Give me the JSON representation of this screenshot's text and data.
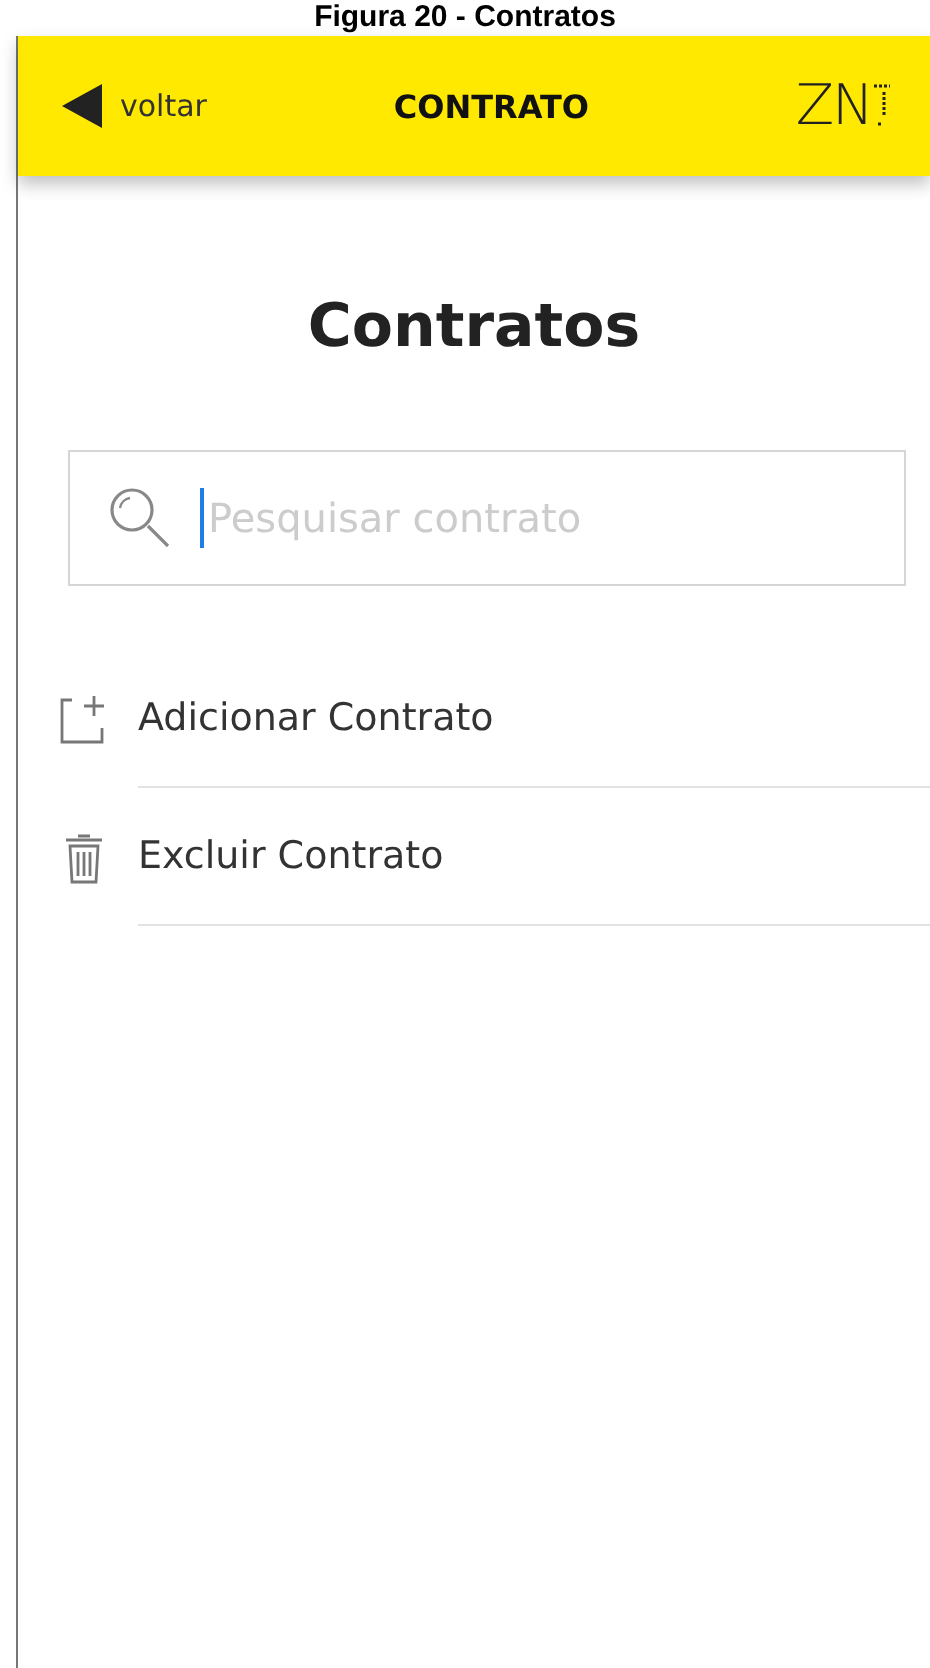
{
  "caption": "Figura 20 - Contratos",
  "header": {
    "back": "voltar",
    "title": "CONTRATO",
    "logo": "ZN"
  },
  "page_title": "Contratos",
  "search": {
    "placeholder": "Pesquisar contrato",
    "focused": true
  },
  "actions": [
    {
      "kind": "add",
      "label": "Adicionar Contrato"
    },
    {
      "kind": "delete",
      "label": "Excluir Contrato"
    }
  ]
}
